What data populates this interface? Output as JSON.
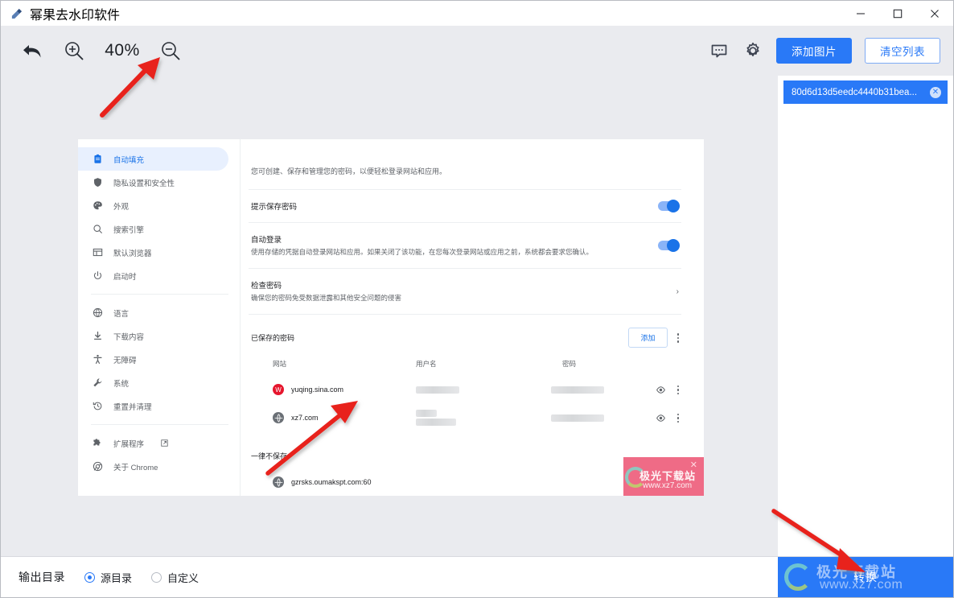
{
  "window": {
    "title": "幂果去水印软件",
    "app_icon": "eraser-icon",
    "minimize": "–",
    "maximize": "□",
    "close": "✕"
  },
  "toolbar": {
    "undo_icon": "undo-arrow-icon",
    "zoom_in_icon": "zoom-in-icon",
    "zoom_level": "40%",
    "zoom_out_icon": "zoom-out-icon",
    "feedback_icon": "chat-bubble-icon",
    "settings_icon": "gear-icon",
    "add_image_label": "添加图片",
    "clear_list_label": "清空列表",
    "primary_color": "#2979f7"
  },
  "file_list": {
    "items": [
      {
        "name": "80d6d13d5eedc4440b31bea...",
        "remove_icon": "close-circle-icon",
        "selected": true
      }
    ]
  },
  "canvas": {
    "screenshot": {
      "sidebar": {
        "group1": [
          {
            "label": "自动填充",
            "icon": "clipboard-icon",
            "active": true
          },
          {
            "label": "隐私设置和安全性",
            "icon": "shield-icon",
            "active": false
          },
          {
            "label": "外观",
            "icon": "palette-icon",
            "active": false
          },
          {
            "label": "搜索引擎",
            "icon": "search-icon",
            "active": false
          },
          {
            "label": "默认浏览器",
            "icon": "browser-window-icon",
            "active": false
          },
          {
            "label": "启动时",
            "icon": "power-icon",
            "active": false
          }
        ],
        "group2": [
          {
            "label": "语言",
            "icon": "globe-icon"
          },
          {
            "label": "下载内容",
            "icon": "download-icon"
          },
          {
            "label": "无障碍",
            "icon": "accessibility-icon"
          },
          {
            "label": "系统",
            "icon": "wrench-icon"
          },
          {
            "label": "重置并清理",
            "icon": "history-restore-icon"
          }
        ],
        "group3": [
          {
            "label": "扩展程序",
            "icon": "puzzle-icon",
            "external": true
          },
          {
            "label": "关于 Chrome",
            "icon": "chrome-icon",
            "external": false
          }
        ]
      },
      "main": {
        "intro": "您可创建、保存和管理您的密码，以便轻松登录网站和应用。",
        "rows": [
          {
            "title": "提示保存密码",
            "sub": "",
            "control": "toggle",
            "on": true
          },
          {
            "title": "自动登录",
            "sub": "使用存储的凭据自动登录网站和应用。如果关闭了该功能，在您每次登录网站或应用之前，系统都会要求您确认。",
            "control": "toggle",
            "on": true
          },
          {
            "title": "检查密码",
            "sub": "确保您的密码免受数据泄露和其他安全问题的侵害",
            "control": "chevron",
            "on": false
          }
        ],
        "saved_title": "已保存的密码",
        "add_label": "添加",
        "more_icon": "kebab-menu-icon",
        "columns": {
          "site": "网站",
          "user": "用户名",
          "password": "密码"
        },
        "password_rows": [
          {
            "site": "yuqing.sina.com",
            "favicon": "weibo-icon",
            "user_masked": true,
            "pass_masked": true,
            "eye_icon": "eye-icon",
            "more_icon": "kebab-menu-icon"
          },
          {
            "site": "xz7.com",
            "favicon": "globe-icon",
            "user_masked": true,
            "pass_masked": true,
            "eye_icon": "eye-icon",
            "more_icon": "kebab-menu-icon"
          }
        ],
        "never_saved_title": "一律不保存",
        "never_saved_rows": [
          {
            "site": "gzrsks.oumakspt.com:60",
            "favicon": "globe-icon"
          }
        ]
      },
      "watermark_sticker": {
        "close_icon": "close-icon",
        "line1": "极光下载站",
        "line2": "www.xz7.com",
        "color": "#ef6b86"
      }
    }
  },
  "bottom": {
    "output_dir_label": "输出目录",
    "options": [
      {
        "label": "源目录",
        "selected": true
      },
      {
        "label": "自定义",
        "selected": false
      }
    ],
    "convert_label": "转换",
    "convert_watermark": {
      "line1": "极光下载站",
      "line2": "www.xz7.com"
    }
  },
  "annotations": {
    "arrow_color": "#e8201a",
    "arrows": [
      {
        "name": "arrow-to-zoom-out"
      },
      {
        "name": "arrow-to-password-row"
      },
      {
        "name": "arrow-to-convert-button"
      }
    ]
  }
}
